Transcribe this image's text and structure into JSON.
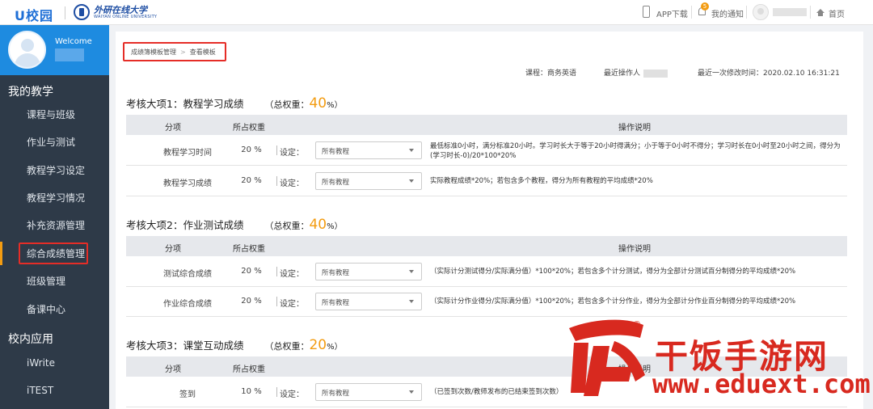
{
  "topbar": {
    "brand": "U校园",
    "university_name": "外研在线大学",
    "university_en": "WAIYAN ONLINE UNIVERSITY",
    "app_download": "APP下载",
    "notice_badge": "5",
    "notice": "我的通知",
    "home": "首页"
  },
  "sidebar": {
    "welcome": "Welcome",
    "group1": "我的教学",
    "items": [
      "课程与班级",
      "作业与测试",
      "教程学习设定",
      "教程学习情况",
      "补充资源管理",
      "综合成绩管理",
      "班级管理",
      "备课中心"
    ],
    "active_index": 5,
    "group2": "校内应用",
    "apps": [
      "iWrite",
      "iTEST"
    ]
  },
  "breadcrumb": {
    "parent": "成绩簿模板管理",
    "separator": ">",
    "current": "查看模板"
  },
  "meta": {
    "course": "课程：商务英语",
    "last_operator": "最近操作人",
    "last_modified": "最近一次修改时间：2020.02.10 16:31:21"
  },
  "table_headers": {
    "item": "分项",
    "weight": "所占权重",
    "desc": "操作说明"
  },
  "setting_label": "设定：",
  "select_default": "所有教程",
  "sections": [
    {
      "title": "考核大项1：教程学习成绩",
      "weight_label": "（总权重：",
      "weight": "40",
      "weight_suffix": "%）",
      "rows": [
        {
          "item": "教程学习时间",
          "weight": "20 %",
          "desc": "最低标准0小时，满分标准20小时。学习时长大于等于20小时得满分；小于等于0小时不得分；学习时长在0小时至20小时之间，得分为(学习时长-0)/20*100*20%"
        },
        {
          "item": "教程学习成绩",
          "weight": "20 %",
          "desc": "实际教程成绩*20%；若包含多个教程，得分为所有教程的平均成绩*20%"
        }
      ]
    },
    {
      "title": "考核大项2：作业测试成绩",
      "weight_label": "（总权重：",
      "weight": "40",
      "weight_suffix": "%）",
      "rows": [
        {
          "item": "测试综合成绩",
          "weight": "20 %",
          "desc": "（实际计分测试得分/实际满分值）*100*20%；若包含多个计分测试，得分为全部计分测试百分制得分的平均成绩*20%"
        },
        {
          "item": "作业综合成绩",
          "weight": "20 %",
          "desc": "（实际计分作业得分/实际满分值）*100*20%；若包含多个计分作业，得分为全部计分作业百分制得分的平均成绩*20%"
        }
      ]
    },
    {
      "title": "考核大项3：课堂互动成绩",
      "weight_label": "（总权重：",
      "weight": "20",
      "weight_suffix": "%）",
      "rows": [
        {
          "item": "签到",
          "weight": "10 %",
          "desc": "（已签到次数/教师发布的已结束签到次数）"
        }
      ]
    }
  ],
  "watermark": {
    "glyph": "饭",
    "text": "干饭手游网",
    "url": "www.eduext.com",
    "reg": "®"
  },
  "colors": {
    "sidebar_bg": "#2e3a48",
    "profile_bg": "#1e8be0",
    "accent_orange": "#f39c12",
    "highlight_red": "#e52d27",
    "watermark_red": "#d8291f"
  }
}
